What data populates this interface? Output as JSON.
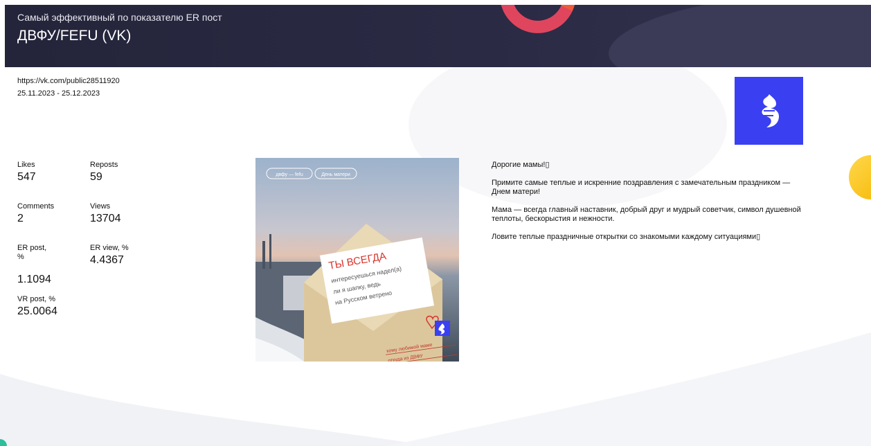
{
  "header": {
    "subtitle": "Самый эффективный по показателю ER пост",
    "title": "ДВФУ/FEFU (VK)"
  },
  "meta": {
    "url": "https://vk.com/public28511920",
    "period": "25.11.2023 - 25.12.2023"
  },
  "logo": {
    "icon": "fefu-flame-logo-icon",
    "color": "#3a3ff2"
  },
  "stats": [
    {
      "label": "Likes",
      "value": "547"
    },
    {
      "label": "Reposts",
      "value": "59"
    },
    {
      "label": "Comments",
      "value": "2"
    },
    {
      "label": "Views",
      "value": "13704"
    },
    {
      "label": "ER post, %",
      "value": "1.1094"
    },
    {
      "label": "ER view, %",
      "value": "4.4367"
    },
    {
      "label": "VR post, %",
      "value": "25.0064"
    }
  ],
  "post_image": {
    "tags": [
      "двфу — fefu",
      "День матери"
    ],
    "card_heading": "ТЫ ВСЕГДА",
    "card_lines": [
      "интересуешься надел(а)",
      "ли я шапку, ведь",
      "на Русском ветрено"
    ],
    "envelope_lines": [
      "кому любимой маме",
      "откуда из ДВФУ"
    ]
  },
  "post_text": [
    "Дорогие мамы!▯",
    "Примите самые теплые и искренние поздравления с замечательным праздником — Днем матери!",
    "Мама — всегда главный наставник, добрый друг и мудрый советчик, символ душевной теплоты, бескорыстия и нежности.",
    "Ловите теплые праздничные открытки со знакомыми каждому ситуациями▯"
  ],
  "colors": {
    "header_bg": "#24243a",
    "accent_red": "#e0455e",
    "accent_yellow": "#ffd84d",
    "brand_blue": "#3a3ff2"
  }
}
